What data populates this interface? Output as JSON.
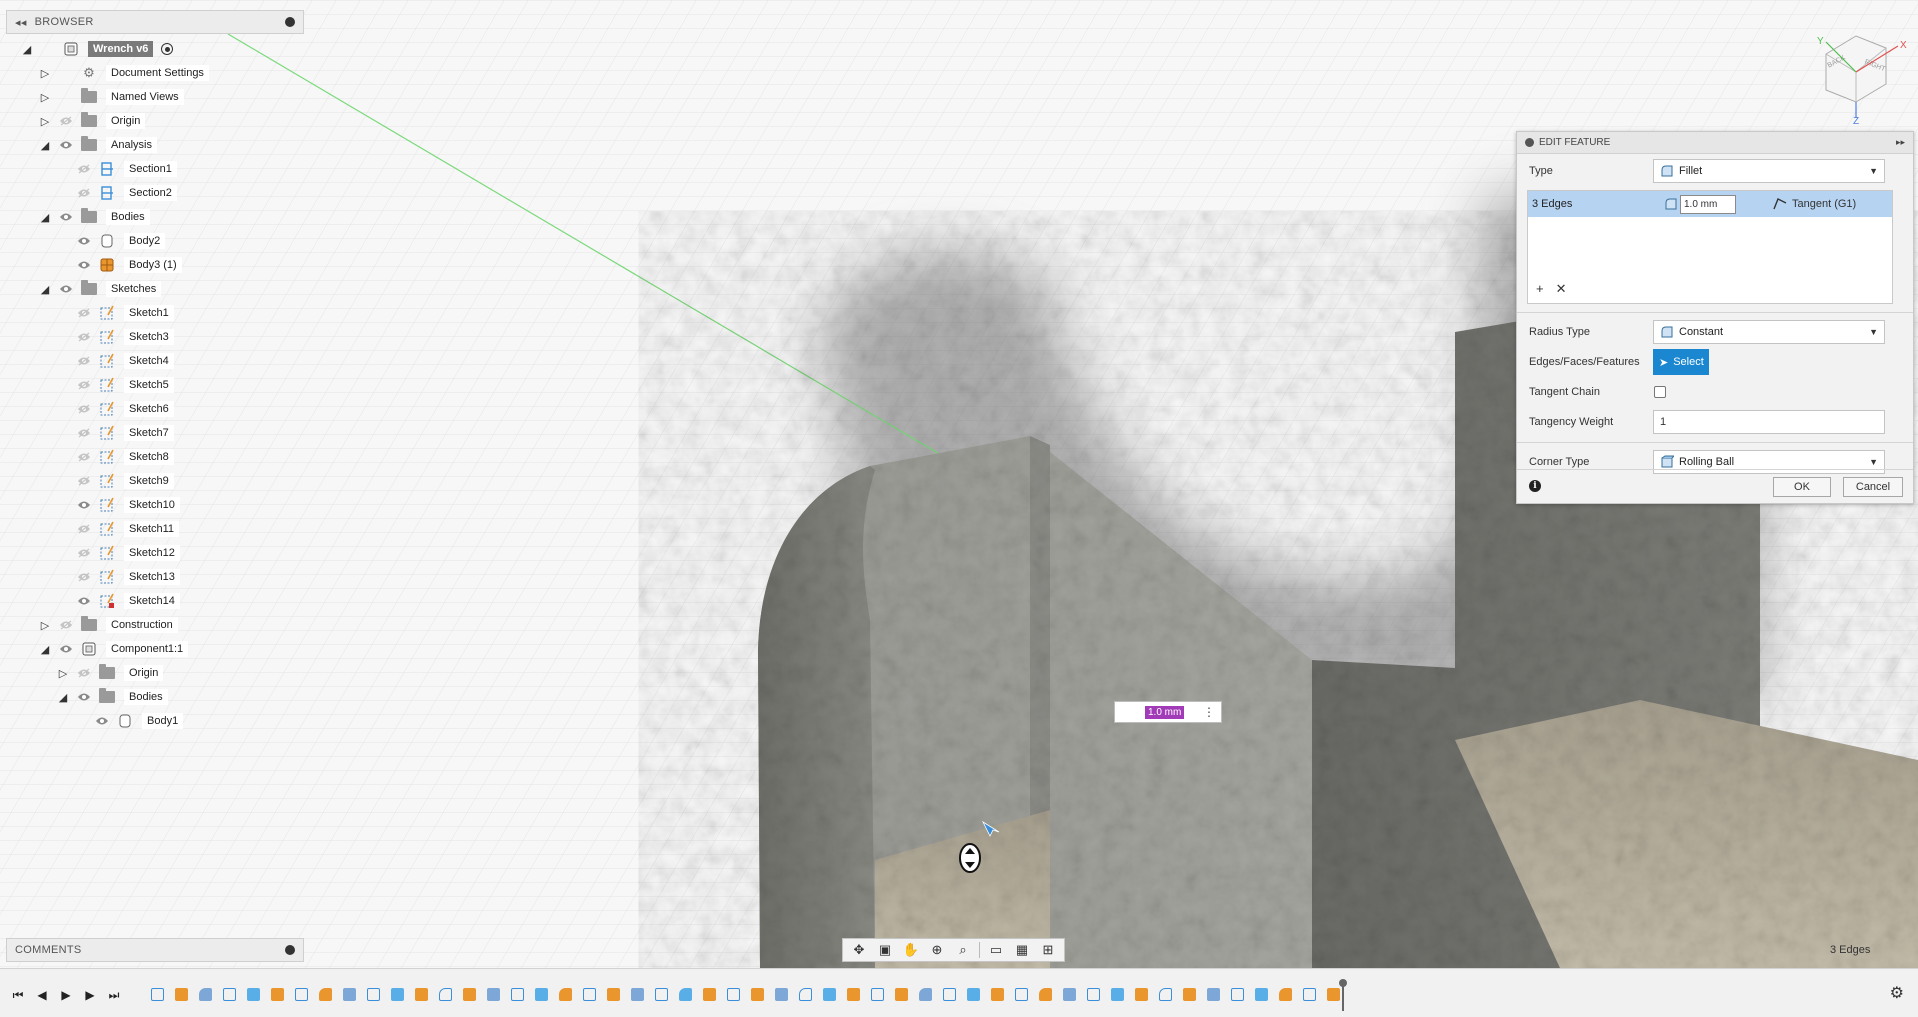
{
  "browser": {
    "title": "BROWSER",
    "items": [
      {
        "label": "Wrench v6",
        "level": 0,
        "toggle": "open",
        "icon": "component"
      },
      {
        "label": "Document Settings",
        "level": 1,
        "toggle": "closed",
        "icon": "gear"
      },
      {
        "label": "Named Views",
        "level": 1,
        "toggle": "closed",
        "icon": "folder"
      },
      {
        "label": "Origin",
        "level": 1,
        "toggle": "closed",
        "icon": "folder",
        "eye": "hidden"
      },
      {
        "label": "Analysis",
        "level": 1,
        "toggle": "open",
        "icon": "folder",
        "eye": "visible"
      },
      {
        "label": "Section1",
        "level": 2,
        "icon": "section",
        "eye": "hidden"
      },
      {
        "label": "Section2",
        "level": 2,
        "icon": "section",
        "eye": "hidden"
      },
      {
        "label": "Bodies",
        "level": 1,
        "toggle": "open",
        "icon": "folder",
        "eye": "visible"
      },
      {
        "label": "Body2",
        "level": 2,
        "icon": "body",
        "eye": "visible"
      },
      {
        "label": "Body3 (1)",
        "level": 2,
        "icon": "body-orange",
        "eye": "visible"
      },
      {
        "label": "Sketches",
        "level": 1,
        "toggle": "open",
        "icon": "folder",
        "eye": "visible"
      },
      {
        "label": "Sketch1",
        "level": 2,
        "icon": "sketch",
        "eye": "hidden"
      },
      {
        "label": "Sketch3",
        "level": 2,
        "icon": "sketch",
        "eye": "hidden"
      },
      {
        "label": "Sketch4",
        "level": 2,
        "icon": "sketch",
        "eye": "hidden"
      },
      {
        "label": "Sketch5",
        "level": 2,
        "icon": "sketch",
        "eye": "hidden"
      },
      {
        "label": "Sketch6",
        "level": 2,
        "icon": "sketch",
        "eye": "hidden"
      },
      {
        "label": "Sketch7",
        "level": 2,
        "icon": "sketch",
        "eye": "hidden"
      },
      {
        "label": "Sketch8",
        "level": 2,
        "icon": "sketch",
        "eye": "hidden"
      },
      {
        "label": "Sketch9",
        "level": 2,
        "icon": "sketch",
        "eye": "hidden"
      },
      {
        "label": "Sketch10",
        "level": 2,
        "icon": "sketch",
        "eye": "visible"
      },
      {
        "label": "Sketch11",
        "level": 2,
        "icon": "sketch",
        "eye": "hidden"
      },
      {
        "label": "Sketch12",
        "level": 2,
        "icon": "sketch",
        "eye": "hidden"
      },
      {
        "label": "Sketch13",
        "level": 2,
        "icon": "sketch",
        "eye": "hidden"
      },
      {
        "label": "Sketch14",
        "level": 2,
        "icon": "sketch-locked",
        "eye": "visible"
      },
      {
        "label": "Construction",
        "level": 1,
        "toggle": "closed",
        "icon": "folder",
        "eye": "hidden"
      },
      {
        "label": "Component1:1",
        "level": 1,
        "toggle": "open",
        "icon": "component",
        "eye": "visible"
      },
      {
        "label": "Origin",
        "level": 2,
        "toggle": "closed",
        "icon": "folder",
        "eye": "hidden"
      },
      {
        "label": "Bodies",
        "level": 2,
        "toggle": "open",
        "icon": "folder",
        "eye": "visible"
      },
      {
        "label": "Body1",
        "level": 3,
        "icon": "body",
        "eye": "visible"
      }
    ]
  },
  "comments": {
    "title": "COMMENTS"
  },
  "edit_feature": {
    "title": "EDIT FEATURE",
    "type_label": "Type",
    "type_value": "Fillet",
    "edge_row": {
      "label": "3 Edges",
      "radius": "1.0 mm",
      "continuity": "Tangent (G1)"
    },
    "radius_type_label": "Radius Type",
    "radius_type_value": "Constant",
    "edges_label": "Edges/Faces/Features",
    "select_label": "Select",
    "tangent_chain_label": "Tangent Chain",
    "tangency_weight_label": "Tangency Weight",
    "tangency_weight_value": "1",
    "corner_type_label": "Corner Type",
    "corner_type_value": "Rolling Ball",
    "ok_label": "OK",
    "cancel_label": "Cancel"
  },
  "viewport": {
    "dimension_value": "1.0 mm",
    "status_text": "3 Edges",
    "viewcube": {
      "top": "TOP",
      "back": "BACK",
      "right": "RIGHT",
      "axis_x": "X",
      "axis_y": "Y",
      "axis_z": "Z"
    }
  },
  "colors": {
    "accent": "#1b87d1",
    "selection": "#b6d4f2",
    "dimension": "#a23bb7",
    "body_orange": "#e8962d",
    "feature_blue": "#3a8fd8"
  }
}
